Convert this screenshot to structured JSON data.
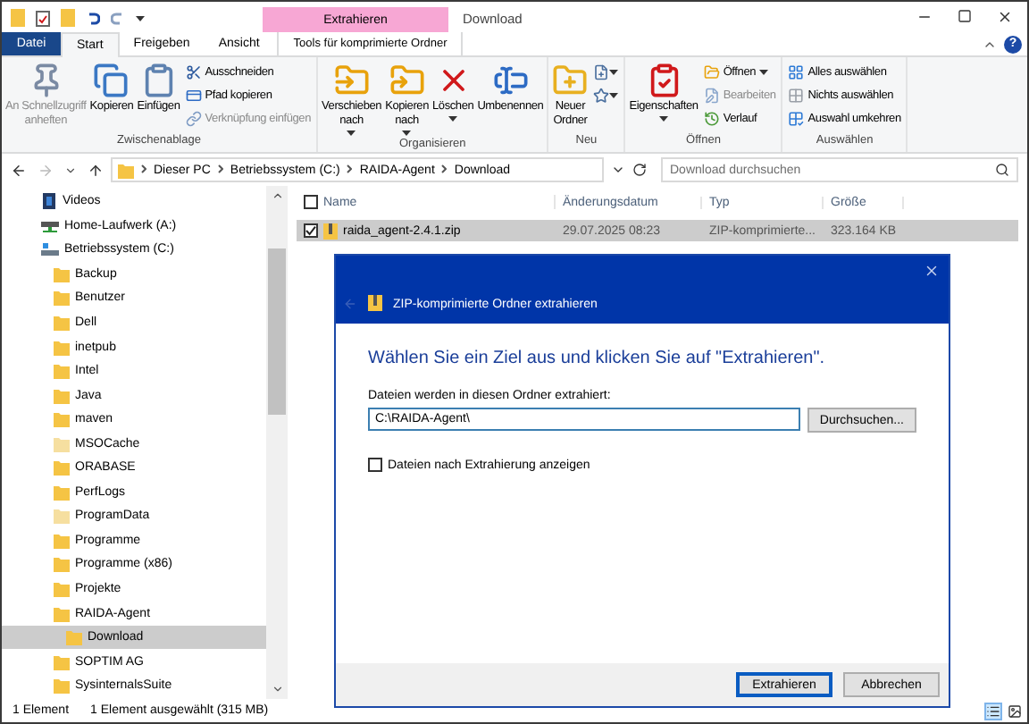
{
  "title_bar": {
    "contextual_tab": "Extrahieren",
    "title": "Download"
  },
  "tabs": [
    {
      "label": "Datei",
      "kind": "file",
      "selected": false
    },
    {
      "label": "Start",
      "kind": "tab",
      "selected": true
    },
    {
      "label": "Freigeben",
      "kind": "tab",
      "selected": false
    },
    {
      "label": "Ansicht",
      "kind": "tab",
      "selected": false
    },
    {
      "label": "Tools für komprimierte Ordner",
      "kind": "contextual",
      "selected": false
    }
  ],
  "help": "?",
  "ribbon": [
    {
      "label": "Zwischenablage",
      "items": [
        {
          "kind": "large",
          "label": "An Schnellzugriff\nanheften",
          "disabled": true,
          "dropdown": false
        },
        {
          "kind": "large",
          "label": "Kopieren",
          "disabled": false,
          "dropdown": false
        },
        {
          "kind": "large",
          "label": "Einfügen",
          "disabled": false,
          "dropdown": false
        },
        {
          "kind": "small",
          "label": "Ausschneiden",
          "disabled": false,
          "dropdown": false
        },
        {
          "kind": "small",
          "label": "Pfad kopieren",
          "disabled": false,
          "dropdown": false
        },
        {
          "kind": "small",
          "label": "Verknüpfung einfügen",
          "disabled": true,
          "dropdown": false
        }
      ]
    },
    {
      "label": "Organisieren",
      "items": [
        {
          "kind": "large",
          "label": "Verschieben\nnach",
          "disabled": false,
          "dropdown": true
        },
        {
          "kind": "large",
          "label": "Kopieren\nnach",
          "disabled": false,
          "dropdown": true
        },
        {
          "kind": "large",
          "label": "Löschen",
          "disabled": false,
          "dropdown": true
        },
        {
          "kind": "large",
          "label": "Umbenennen",
          "disabled": false,
          "dropdown": false
        }
      ]
    },
    {
      "label": "Neu",
      "items": [
        {
          "kind": "large",
          "label": "Neuer\nOrdner",
          "disabled": false,
          "dropdown": false
        },
        {
          "kind": "icon",
          "disabled": false,
          "dropdown": true
        },
        {
          "kind": "icon",
          "disabled": false,
          "dropdown": true
        }
      ]
    },
    {
      "label": "Öffnen",
      "items": [
        {
          "kind": "large",
          "label": "Eigenschaften",
          "disabled": false,
          "dropdown": true
        },
        {
          "kind": "small",
          "label": "Öffnen",
          "disabled": false,
          "dropdown": true
        },
        {
          "kind": "small",
          "label": "Bearbeiten",
          "disabled": true,
          "dropdown": false
        },
        {
          "kind": "small",
          "label": "Verlauf",
          "disabled": false,
          "dropdown": false
        }
      ]
    },
    {
      "label": "Auswählen",
      "items": [
        {
          "kind": "small",
          "label": "Alles auswählen",
          "disabled": false,
          "dropdown": false
        },
        {
          "kind": "small",
          "label": "Nichts auswählen",
          "disabled": false,
          "dropdown": false
        },
        {
          "kind": "small",
          "label": "Auswahl umkehren",
          "disabled": false,
          "dropdown": false
        }
      ]
    }
  ],
  "address": {
    "crumbs": [
      "Dieser PC",
      "Betriebssystem (C:)",
      "RAIDA-Agent",
      "Download"
    ],
    "search_placeholder": "Download durchsuchen"
  },
  "tree": [
    {
      "label": "Videos",
      "kind": "videos",
      "selected": false
    },
    {
      "label": "Home-Laufwerk (A:)",
      "kind": "network",
      "selected": false
    },
    {
      "label": "Betriebssystem (C:)",
      "kind": "drive",
      "selected": false,
      "children": [
        {
          "label": "Backup",
          "kind": "folder",
          "selected": false
        },
        {
          "label": "Benutzer",
          "kind": "folder",
          "selected": false
        },
        {
          "label": "Dell",
          "kind": "folder",
          "selected": false
        },
        {
          "label": "inetpub",
          "kind": "folder",
          "selected": false
        },
        {
          "label": "Intel",
          "kind": "folder",
          "selected": false
        },
        {
          "label": "Java",
          "kind": "folder",
          "selected": false
        },
        {
          "label": "maven",
          "kind": "folder",
          "selected": false
        },
        {
          "label": "MSOCache",
          "kind": "hidden-folder",
          "selected": false
        },
        {
          "label": "ORABASE",
          "kind": "folder",
          "selected": false
        },
        {
          "label": "PerfLogs",
          "kind": "folder",
          "selected": false
        },
        {
          "label": "ProgramData",
          "kind": "hidden-folder",
          "selected": false
        },
        {
          "label": "Programme",
          "kind": "folder",
          "selected": false
        },
        {
          "label": "Programme (x86)",
          "kind": "folder",
          "selected": false
        },
        {
          "label": "Projekte",
          "kind": "folder",
          "selected": false
        },
        {
          "label": "RAIDA-Agent",
          "kind": "folder",
          "selected": false,
          "children": [
            {
              "label": "Download",
              "kind": "folder",
              "selected": true
            }
          ]
        },
        {
          "label": "SOPTIM AG",
          "kind": "folder",
          "selected": false
        },
        {
          "label": "SysinternalsSuite",
          "kind": "folder",
          "selected": false
        }
      ]
    }
  ],
  "files": {
    "columns": [
      "Name",
      "Änderungsdatum",
      "Typ",
      "Größe"
    ],
    "all_checked": false,
    "rows": [
      {
        "name": "raida_agent-2.4.1.zip",
        "date": "29.07.2025 08:23",
        "type": "ZIP-komprimierte...",
        "size": "323.164 KB",
        "selected": true,
        "checked": true
      }
    ]
  },
  "dialog": {
    "title": "ZIP-komprimierte Ordner extrahieren",
    "heading": "Wählen Sie ein Ziel aus und klicken Sie auf \"Extrahieren\".",
    "field_label": "Dateien werden in diesen Ordner extrahiert:",
    "path": "C:\\RAIDA-Agent\\",
    "browse": "Durchsuchen...",
    "show_files": {
      "label": "Dateien nach Extrahierung anzeigen",
      "checked": false
    },
    "buttons": [
      {
        "label": "Extrahieren",
        "default": true
      },
      {
        "label": "Abbrechen",
        "default": false
      }
    ]
  },
  "status_bar": {
    "count": "1 Element",
    "selection": "1 Element ausgewählt (315 MB)",
    "views": [
      {
        "kind": "details",
        "selected": true
      },
      {
        "kind": "tiles",
        "selected": false
      }
    ]
  }
}
